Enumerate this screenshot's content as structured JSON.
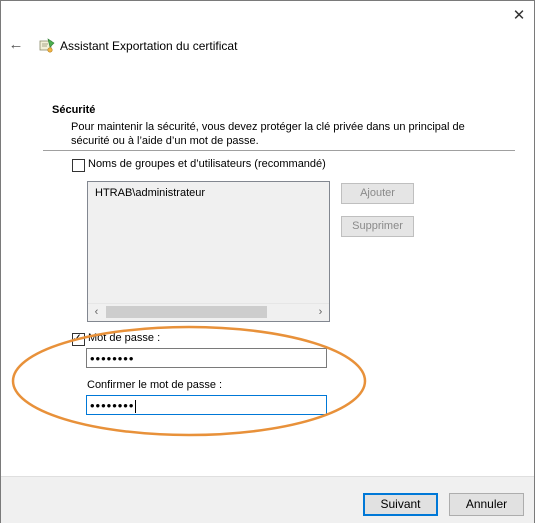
{
  "window": {
    "title": "Assistant Exportation du certificat",
    "close_glyph": "✕",
    "back_glyph": "←",
    "app_icon": "certificate-icon"
  },
  "security": {
    "heading": "Sécurité",
    "description": "Pour maintenir la sécurité, vous devez protéger la clé privée dans un principal de sécurité ou à l’aide d’un mot de passe."
  },
  "groups": {
    "checkbox_label": "Noms de groupes et d’utilisateurs (recommandé)",
    "checked": false,
    "list_items": [
      "HTRAB\\administrateur"
    ],
    "add_label": "Ajouter",
    "remove_label": "Supprimer",
    "scroll_left_glyph": "‹",
    "scroll_right_glyph": "›"
  },
  "password": {
    "checkbox_label": "Mot de passe :",
    "checked": true,
    "check_glyph": "✓",
    "value": "••••••••",
    "confirm_label": "Confirmer le mot de passe :",
    "confirm_value": "••••••••"
  },
  "colors": {
    "annotation": "#e8913a",
    "accent": "#0078d7"
  },
  "footer": {
    "next_label": "Suivant",
    "cancel_label": "Annuler"
  }
}
